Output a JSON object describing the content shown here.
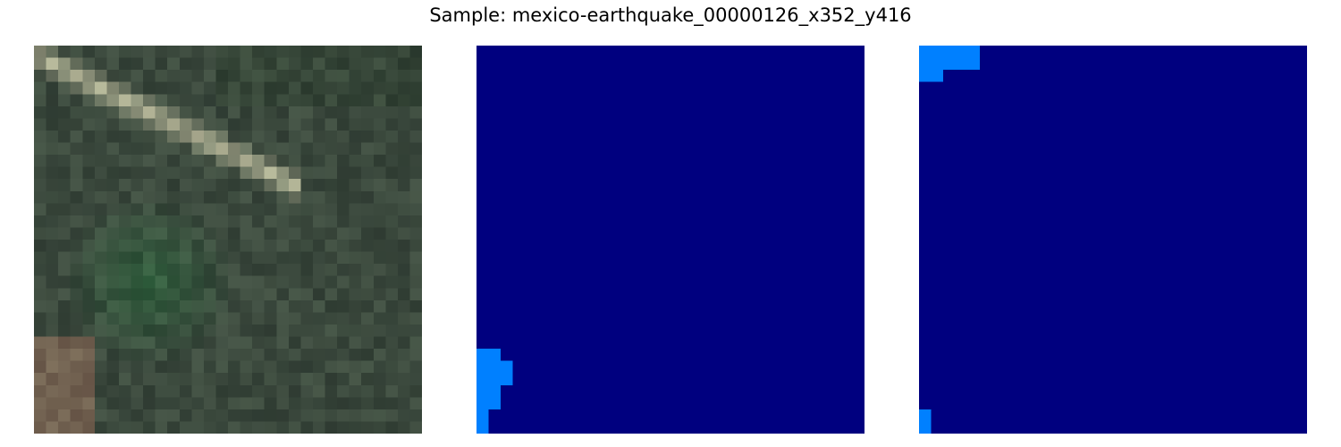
{
  "title": "Sample: mexico-earthquake_00000126_x352_y416",
  "colors": {
    "background": "#ffffff",
    "mask_background": "#00007f",
    "mask_foreground": "#0080ff"
  },
  "panels": [
    {
      "name": "satellite-image",
      "content": "aerial imagery patch"
    },
    {
      "name": "mask-panel-2",
      "content": "segmentation mask"
    },
    {
      "name": "mask-panel-3",
      "content": "segmentation mask"
    }
  ]
}
